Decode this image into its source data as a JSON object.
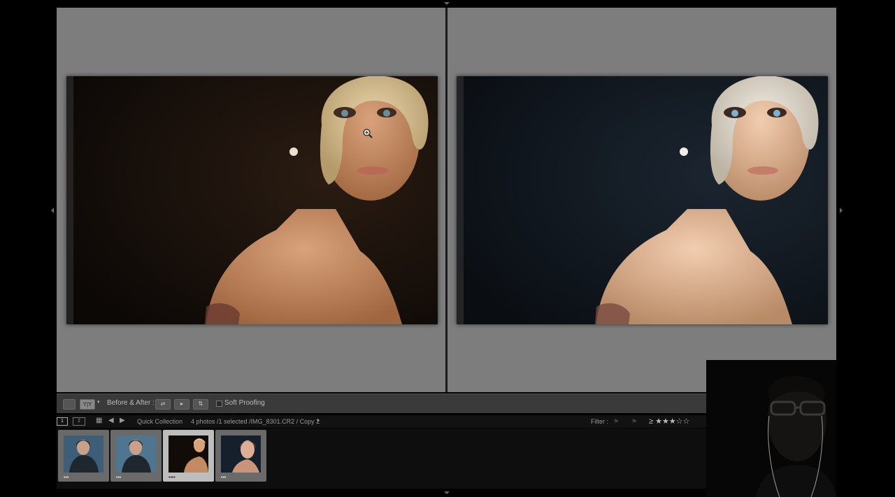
{
  "toolbar": {
    "view_label": "Y|Y",
    "before_after_label": "Before & After :",
    "soft_proofing_label": "Soft Proofing"
  },
  "filmstrip_bar": {
    "page1": "1",
    "page2": "2",
    "source": "Quick Collection",
    "info": "4 photos /1 selected /IMG_8301.CR2 / Copy 2",
    "filter_label": "Filter :",
    "rating_filter": "≥ ★★★☆☆"
  },
  "thumbnails": [
    {
      "dots": "•••",
      "selected": false
    },
    {
      "dots": "•••",
      "selected": false
    },
    {
      "dots": "••••",
      "selected": true
    },
    {
      "dots": "•••",
      "selected": false
    }
  ],
  "colors": {
    "canvas_bg": "#7d7d7d",
    "panel_bg": "#3a3a3a",
    "filmstrip_bg": "#0e0e0e",
    "selected_cell": "#bdbdbd"
  }
}
